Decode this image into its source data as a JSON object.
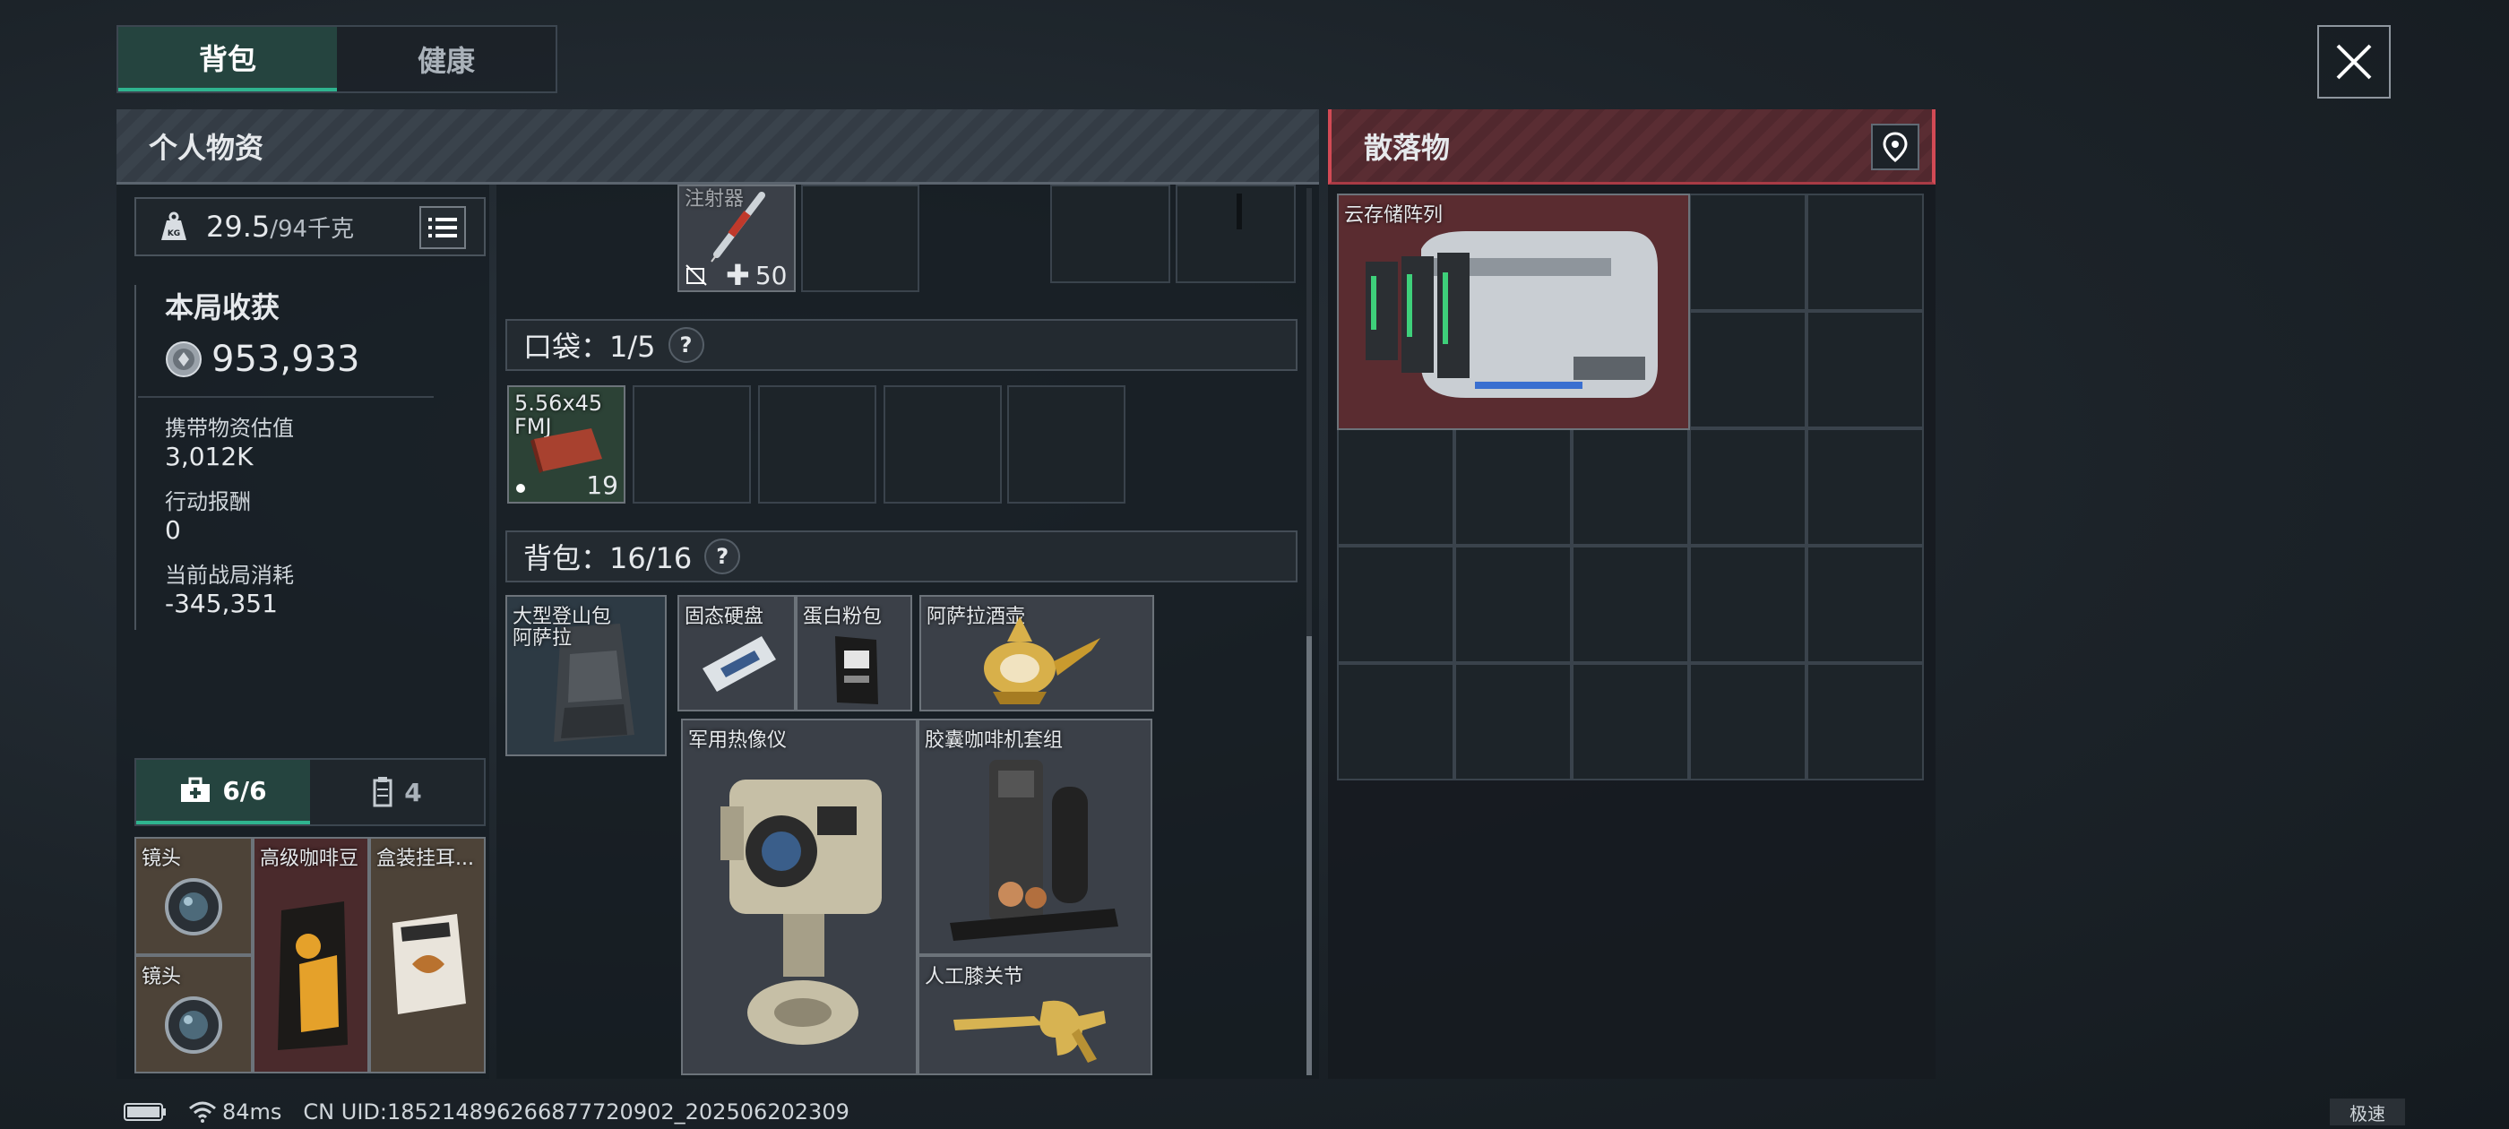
{
  "tabs": [
    {
      "label": "背包",
      "active": true
    },
    {
      "label": "健康",
      "active": false
    }
  ],
  "personal": {
    "header": "个人物资",
    "weight": {
      "current": "29.5",
      "max": "/94千克"
    },
    "harvest": {
      "title": "本局收获",
      "coins": "953,933",
      "carry_value_label": "携带物资估值",
      "carry_value": "3,012K",
      "reward_label": "行动报酬",
      "reward": "0",
      "consume_label": "当前战局消耗",
      "consume": "-345,351"
    },
    "bottom_tabs": [
      {
        "label": "6/6",
        "icon": "medkit-icon",
        "active": true
      },
      {
        "label": "4",
        "icon": "magazine-icon",
        "active": false
      }
    ],
    "stash_items": [
      {
        "name": "镜头"
      },
      {
        "name": "高级咖啡豆"
      },
      {
        "name": "盒装挂耳..."
      },
      {
        "name": "镜头"
      }
    ]
  },
  "container": {
    "top_item_name": "注射器",
    "top_item_value": "50",
    "pocket_label": "口袋：1/5",
    "pocket_items": [
      {
        "name": "5.56x45",
        "subname": "FMJ",
        "count": "19"
      }
    ],
    "backpack_label": "背包：16/16",
    "backpack_items": [
      {
        "name": "大型登山包",
        "subname": "阿萨拉"
      },
      {
        "name": "固态硬盘"
      },
      {
        "name": "蛋白粉包"
      },
      {
        "name": "阿萨拉酒壶"
      },
      {
        "name": "军用热像仪"
      },
      {
        "name": "胶囊咖啡机套组"
      },
      {
        "name": "人工膝关节"
      }
    ]
  },
  "loot": {
    "header": "散落物",
    "items": [
      {
        "name": "云存储阵列"
      }
    ]
  },
  "status": {
    "ping": "84ms",
    "uid": "CN UID:185214896266877720902_202506202309",
    "speed_label": "极速"
  }
}
